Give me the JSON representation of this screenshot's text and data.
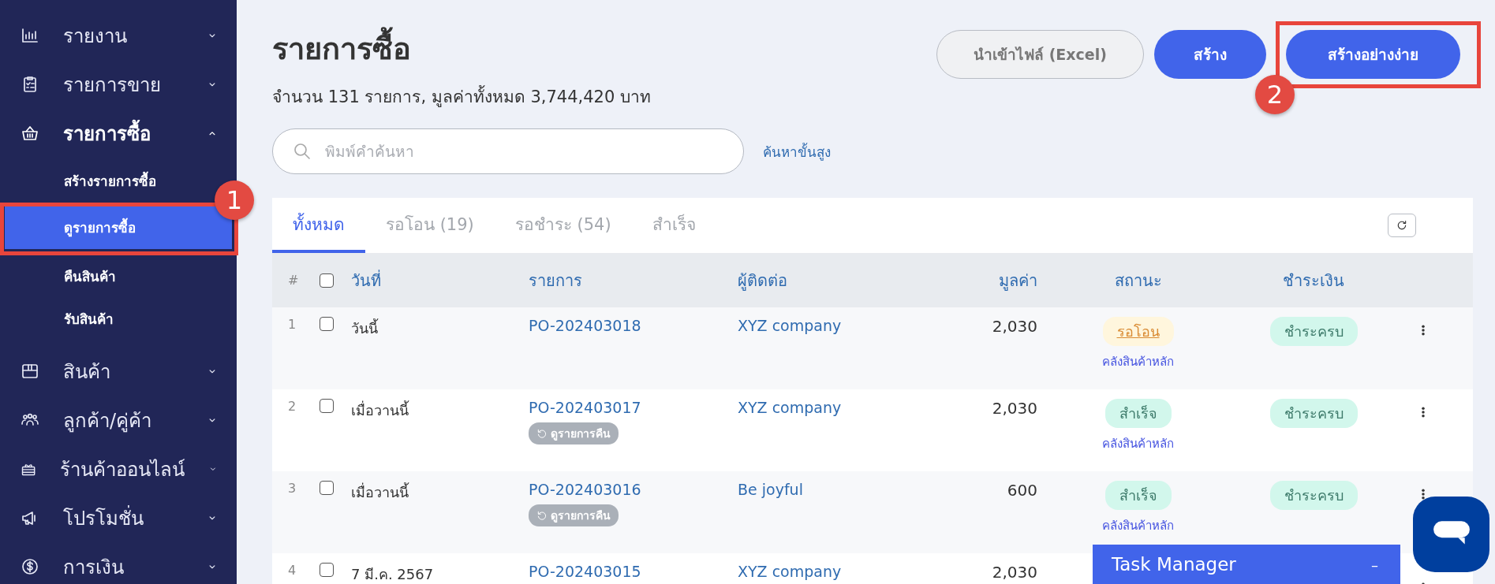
{
  "sidebar": {
    "items": [
      {
        "label": "รายงาน",
        "expanded": false
      },
      {
        "label": "รายการขาย",
        "expanded": false
      },
      {
        "label": "รายการซื้อ",
        "expanded": true,
        "children": [
          {
            "label": "สร้างรายการซื้อ",
            "selected": false
          },
          {
            "label": "ดูรายการซื้อ",
            "selected": true
          },
          {
            "label": "คืนสินค้า",
            "selected": false
          },
          {
            "label": "รับสินค้า",
            "selected": false
          }
        ]
      },
      {
        "label": "สินค้า",
        "expanded": false
      },
      {
        "label": "ลูกค้า/คู่ค้า",
        "expanded": false
      },
      {
        "label": "ร้านค้าออนไลน์",
        "expanded": false
      },
      {
        "label": "โปรโมชั่น",
        "expanded": false
      },
      {
        "label": "การเงิน",
        "expanded": false
      }
    ]
  },
  "header": {
    "title": "รายการซื้อ",
    "summary": "จำนวน 131 รายการ, มูลค่าทั้งหมด 3,744,420 บาท",
    "buttons": [
      {
        "label": "นำเข้าไฟล์ (Excel)",
        "kind": "secondary"
      },
      {
        "label": "สร้าง",
        "kind": "primary"
      },
      {
        "label": "สร้างอย่างง่าย",
        "kind": "primary"
      }
    ]
  },
  "search": {
    "placeholder": "พิมพ์คำค้นหา",
    "advanced_link": "ค้นหาขั้นสูง"
  },
  "tabs": [
    {
      "label": "ทั้งหมด",
      "selected": true
    },
    {
      "label": "รอโอน (19)",
      "selected": false
    },
    {
      "label": "รอชำระ (54)",
      "selected": false
    },
    {
      "label": "สำเร็จ",
      "selected": false
    }
  ],
  "table": {
    "select_all_checked": false,
    "columns": [
      "#",
      "วันที่",
      "รายการ",
      "ผู้ติดต่อ",
      "มูลค่า",
      "สถานะ",
      "ชำระเงิน"
    ],
    "rows": [
      {
        "number": "1",
        "checked": false,
        "date": "วันนี้",
        "order": "PO-202403018",
        "contact": "XYZ company",
        "amount": "2,030",
        "status": {
          "label": "รอโอน",
          "kind": "pending"
        },
        "warehouse": "คลังสินค้าหลัก",
        "payment": "ชำระครบ"
      },
      {
        "number": "2",
        "checked": false,
        "date": "เมื่อวานนี้",
        "order": "PO-202403017",
        "return_link": "ดูรายการคืน",
        "contact": "XYZ company",
        "amount": "2,030",
        "status": {
          "label": "สำเร็จ",
          "kind": "done"
        },
        "warehouse": "คลังสินค้าหลัก",
        "payment": "ชำระครบ"
      },
      {
        "number": "3",
        "checked": false,
        "date": "เมื่อวานนี้",
        "order": "PO-202403016",
        "return_link": "ดูรายการคืน",
        "contact": "Be joyful",
        "amount": "600",
        "status": {
          "label": "สำเร็จ",
          "kind": "done"
        },
        "warehouse": "คลังสินค้าหลัก",
        "payment": "ชำระครบ"
      },
      {
        "number": "4",
        "checked": false,
        "date": "7 มี.ค. 2567",
        "order": "PO-202403015",
        "contact": "XYZ company",
        "amount": "2,030"
      }
    ]
  },
  "task_manager": {
    "title": "Task Manager",
    "minimize": "–"
  },
  "annotations": [
    {
      "label": "1"
    },
    {
      "label": "2"
    }
  ]
}
